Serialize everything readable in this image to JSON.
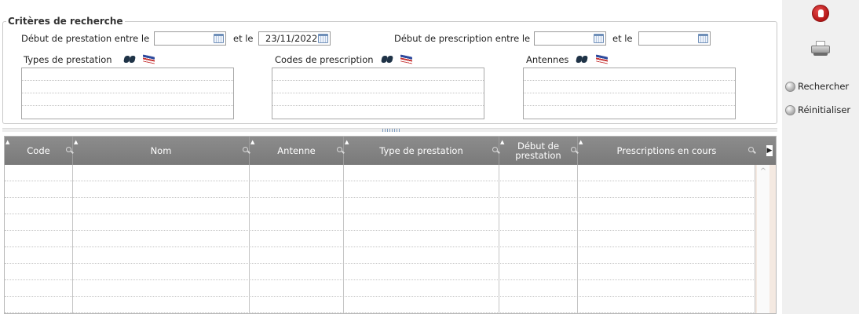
{
  "criteria": {
    "legend": "Critères de recherche",
    "prestation_start_label": "Début de prestation entre le",
    "prestation_and_label": "et le",
    "prestation_from_value": "",
    "prestation_to_value": "23/11/2022",
    "prescription_start_label": "Début de prescription entre le",
    "prescription_and_label": "et le",
    "prescription_from_value": "",
    "prescription_to_value": "",
    "lists": [
      {
        "label": "Types de prestation",
        "items": []
      },
      {
        "label": "Codes de prescription",
        "items": []
      },
      {
        "label": "Antennes",
        "items": []
      }
    ]
  },
  "grid": {
    "columns": [
      {
        "label": "Code"
      },
      {
        "label": "Nom"
      },
      {
        "label": "Antenne"
      },
      {
        "label": "Type de prestation"
      },
      {
        "label": "Début de prestation"
      },
      {
        "label": "Prescriptions en cours"
      }
    ],
    "rows": []
  },
  "side_panel": {
    "search_label": "Rechercher",
    "reset_label": "Réinitialiser"
  },
  "icons": {
    "stop": "stop-hand-icon",
    "print": "printer-icon",
    "search_list": "binoculars-icon",
    "clear_list": "flag-eraser-icon",
    "date_picker": "calendar-icon",
    "column_filter": "magnifier-icon"
  }
}
